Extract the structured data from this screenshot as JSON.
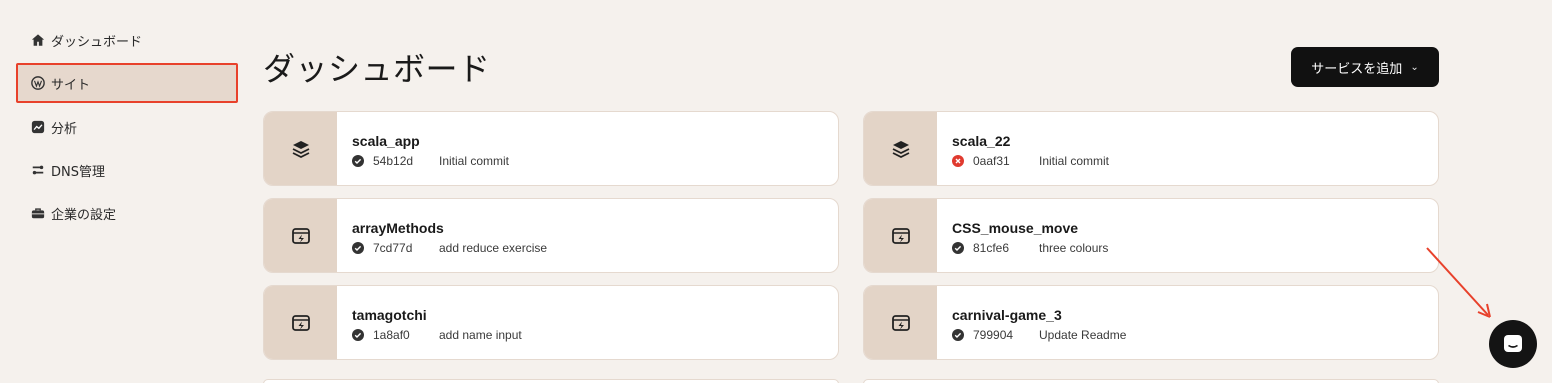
{
  "sidebar": {
    "items": [
      {
        "label": "ダッシュボード",
        "icon": "home-icon"
      },
      {
        "label": "サイト",
        "icon": "wordpress-icon",
        "active": true
      },
      {
        "label": "分析",
        "icon": "analytics-icon"
      },
      {
        "label": "DNS管理",
        "icon": "dns-icon"
      },
      {
        "label": "企業の設定",
        "icon": "briefcase-icon"
      }
    ]
  },
  "header": {
    "title": "ダッシュボード",
    "add_service_label": "サービスを追加"
  },
  "services": [
    {
      "name": "scala_app",
      "commit": "54b12d",
      "message": "Initial commit",
      "status": "success",
      "icon": "layers-icon"
    },
    {
      "name": "scala_22",
      "commit": "0aaf31",
      "message": "Initial commit",
      "status": "error",
      "icon": "layers-icon"
    },
    {
      "name": "arrayMethods",
      "commit": "7cd77d",
      "message": "add reduce exercise",
      "status": "success",
      "icon": "static-site-icon"
    },
    {
      "name": "CSS_mouse_move",
      "commit": "81cfe6",
      "message": "three colours",
      "status": "success",
      "icon": "static-site-icon"
    },
    {
      "name": "tamagotchi",
      "commit": "1a8af0",
      "message": "add name input",
      "status": "success",
      "icon": "static-site-icon"
    },
    {
      "name": "carnival-game_3",
      "commit": "799904",
      "message": "Update Readme",
      "status": "success",
      "icon": "static-site-icon"
    }
  ],
  "colors": {
    "background": "#f5f1ed",
    "card_icon_bg": "#e3d4c7",
    "highlight": "#e8412b",
    "error": "#e03a2f"
  }
}
